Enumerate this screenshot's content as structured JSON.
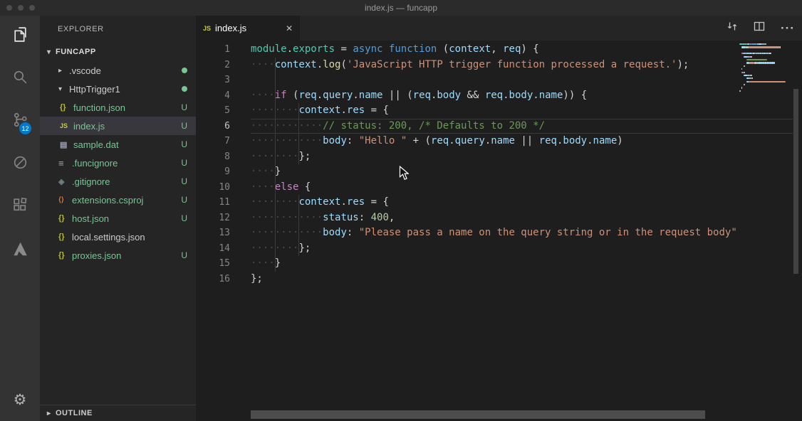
{
  "window": {
    "title": "index.js — funcapp"
  },
  "activity_bar": {
    "items": [
      {
        "name": "explorer",
        "active": true
      },
      {
        "name": "search",
        "active": false
      },
      {
        "name": "source-control",
        "active": false,
        "badge": "12"
      },
      {
        "name": "debug",
        "active": false
      },
      {
        "name": "extensions",
        "active": false
      },
      {
        "name": "azure",
        "active": false
      }
    ],
    "settings_gear": "⚙"
  },
  "sidebar": {
    "header": "EXPLORER",
    "section_label": "FUNCAPP",
    "outline_label": "OUTLINE",
    "items": [
      {
        "label": ".vscode",
        "kind": "folder",
        "arrow": "collapsed",
        "badge": "dot",
        "indent": 0
      },
      {
        "label": "HttpTrigger1",
        "kind": "folder",
        "arrow": "expanded",
        "badge": "dot",
        "indent": 0
      },
      {
        "label": "function.json",
        "kind": "json",
        "badge": "U",
        "indent": 1
      },
      {
        "label": "index.js",
        "kind": "js",
        "badge": "U",
        "indent": 1,
        "selected": true
      },
      {
        "label": "sample.dat",
        "kind": "file",
        "badge": "U",
        "indent": 1
      },
      {
        "label": ".funcignore",
        "kind": "list",
        "badge": "U",
        "indent": 0
      },
      {
        "label": ".gitignore",
        "kind": "git",
        "badge": "U",
        "indent": 0
      },
      {
        "label": "extensions.csproj",
        "kind": "xml",
        "badge": "U",
        "indent": 0
      },
      {
        "label": "host.json",
        "kind": "json",
        "badge": "U",
        "indent": 0
      },
      {
        "label": "local.settings.json",
        "kind": "json",
        "badge": "",
        "indent": 0
      },
      {
        "label": "proxies.json",
        "kind": "json",
        "badge": "U",
        "indent": 0
      }
    ]
  },
  "editor": {
    "tab": {
      "label": "index.js",
      "icon_text": "JS",
      "close_glyph": "✕"
    },
    "more_glyph": "···",
    "active_line": 6,
    "code_lines": [
      {
        "tokens": [
          [
            "teal",
            "module"
          ],
          [
            "def",
            "."
          ],
          [
            "teal",
            "exports"
          ],
          [
            "def",
            " = "
          ],
          [
            "kw",
            "async"
          ],
          [
            "def",
            " "
          ],
          [
            "kw",
            "function"
          ],
          [
            "def",
            " ("
          ],
          [
            "var",
            "context"
          ],
          [
            "def",
            ", "
          ],
          [
            "var",
            "req"
          ],
          [
            "def",
            ") {"
          ]
        ]
      },
      {
        "tokens": [
          [
            "ws",
            "····"
          ],
          [
            "var",
            "context"
          ],
          [
            "def",
            "."
          ],
          [
            "fn",
            "log"
          ],
          [
            "def",
            "("
          ],
          [
            "str",
            "'JavaScript HTTP trigger function processed a request.'"
          ],
          [
            "def",
            ");"
          ]
        ]
      },
      {
        "tokens": []
      },
      {
        "tokens": [
          [
            "ws",
            "····"
          ],
          [
            "ctrl",
            "if"
          ],
          [
            "def",
            " ("
          ],
          [
            "var",
            "req"
          ],
          [
            "def",
            "."
          ],
          [
            "var",
            "query"
          ],
          [
            "def",
            "."
          ],
          [
            "var",
            "name"
          ],
          [
            "def",
            " || ("
          ],
          [
            "var",
            "req"
          ],
          [
            "def",
            "."
          ],
          [
            "var",
            "body"
          ],
          [
            "def",
            " && "
          ],
          [
            "var",
            "req"
          ],
          [
            "def",
            "."
          ],
          [
            "var",
            "body"
          ],
          [
            "def",
            "."
          ],
          [
            "var",
            "name"
          ],
          [
            "def",
            ")) {"
          ]
        ]
      },
      {
        "tokens": [
          [
            "ws",
            "········"
          ],
          [
            "var",
            "context"
          ],
          [
            "def",
            "."
          ],
          [
            "var",
            "res"
          ],
          [
            "def",
            " = {"
          ]
        ]
      },
      {
        "tokens": [
          [
            "ws",
            "············"
          ],
          [
            "cmt",
            "// status: 200, /* Defaults to 200 */"
          ]
        ]
      },
      {
        "tokens": [
          [
            "ws",
            "············"
          ],
          [
            "var",
            "body"
          ],
          [
            "def",
            ": "
          ],
          [
            "str",
            "\"Hello \""
          ],
          [
            "def",
            " + ("
          ],
          [
            "var",
            "req"
          ],
          [
            "def",
            "."
          ],
          [
            "var",
            "query"
          ],
          [
            "def",
            "."
          ],
          [
            "var",
            "name"
          ],
          [
            "def",
            " || "
          ],
          [
            "var",
            "req"
          ],
          [
            "def",
            "."
          ],
          [
            "var",
            "body"
          ],
          [
            "def",
            "."
          ],
          [
            "var",
            "name"
          ],
          [
            "def",
            ")"
          ]
        ]
      },
      {
        "tokens": [
          [
            "ws",
            "········"
          ],
          [
            "def",
            "};"
          ]
        ]
      },
      {
        "tokens": [
          [
            "ws",
            "····"
          ],
          [
            "def",
            "}"
          ]
        ]
      },
      {
        "tokens": [
          [
            "ws",
            "····"
          ],
          [
            "ctrl",
            "else"
          ],
          [
            "def",
            " {"
          ]
        ]
      },
      {
        "tokens": [
          [
            "ws",
            "········"
          ],
          [
            "var",
            "context"
          ],
          [
            "def",
            "."
          ],
          [
            "var",
            "res"
          ],
          [
            "def",
            " = {"
          ]
        ]
      },
      {
        "tokens": [
          [
            "ws",
            "············"
          ],
          [
            "var",
            "status"
          ],
          [
            "def",
            ": "
          ],
          [
            "num",
            "400"
          ],
          [
            "def",
            ","
          ]
        ]
      },
      {
        "tokens": [
          [
            "ws",
            "············"
          ],
          [
            "var",
            "body"
          ],
          [
            "def",
            ": "
          ],
          [
            "str",
            "\"Please pass a name on the query string or in the request body\""
          ]
        ]
      },
      {
        "tokens": [
          [
            "ws",
            "········"
          ],
          [
            "def",
            "};"
          ]
        ]
      },
      {
        "tokens": [
          [
            "ws",
            "····"
          ],
          [
            "def",
            "}"
          ]
        ]
      },
      {
        "tokens": [
          [
            "def",
            "};"
          ]
        ]
      }
    ]
  },
  "colors": {
    "untracked": "#73c991",
    "badge_bg": "#007acc",
    "tokens": {
      "kw": "#569cd6",
      "ctrl": "#c586c0",
      "var": "#9cdcfe",
      "fn": "#dcdcaa",
      "str": "#ce9178",
      "num": "#b5cea8",
      "cmt": "#6a9955",
      "teal": "#4ec9b0",
      "def": "#d4d4d4",
      "ws": "#4b4b52"
    }
  }
}
